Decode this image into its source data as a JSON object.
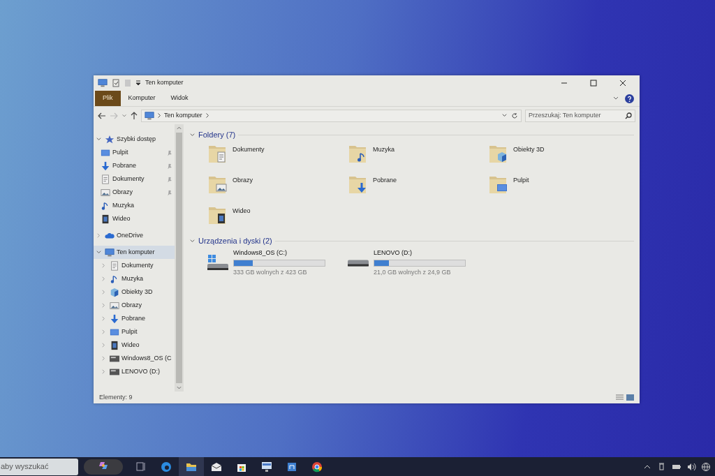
{
  "window": {
    "title": "Ten komputer"
  },
  "ribbon_tabs": [
    {
      "label": "Plik",
      "kind": "file"
    },
    {
      "label": "Komputer",
      "kind": "tab"
    },
    {
      "label": "Widok",
      "kind": "tab"
    }
  ],
  "address": {
    "path": [
      "Ten komputer"
    ]
  },
  "search": {
    "placeholder": "Przeszukaj: Ten komputer"
  },
  "nav": [
    {
      "label": "Szybki dostęp",
      "kind": "star",
      "expanded": true,
      "selected": false,
      "children": [
        {
          "label": "Pulpit",
          "kind": "desktop",
          "pinned": true,
          "selected": false
        },
        {
          "label": "Pobrane",
          "kind": "downloads",
          "pinned": true,
          "selected": false
        },
        {
          "label": "Dokumenty",
          "kind": "documents",
          "pinned": true,
          "selected": false
        },
        {
          "label": "Obrazy",
          "kind": "pictures",
          "pinned": true,
          "selected": false
        },
        {
          "label": "Muzyka",
          "kind": "music",
          "pinned": false,
          "selected": false
        },
        {
          "label": "Wideo",
          "kind": "videos",
          "pinned": false,
          "selected": false
        }
      ]
    },
    {
      "label": "OneDrive",
      "kind": "cloud",
      "expanded": false,
      "selected": false
    },
    {
      "label": "Ten komputer",
      "kind": "computer",
      "expanded": true,
      "selected": true,
      "children": [
        {
          "label": "Dokumenty",
          "kind": "documents",
          "expanded": false,
          "selected": false
        },
        {
          "label": "Muzyka",
          "kind": "music",
          "expanded": false,
          "selected": false
        },
        {
          "label": "Obiekty 3D",
          "kind": "objects3d",
          "expanded": false,
          "selected": false
        },
        {
          "label": "Obrazy",
          "kind": "pictures",
          "expanded": false,
          "selected": false
        },
        {
          "label": "Pobrane",
          "kind": "downloads",
          "expanded": false,
          "selected": false
        },
        {
          "label": "Pulpit",
          "kind": "desktop",
          "expanded": false,
          "selected": false
        },
        {
          "label": "Wideo",
          "kind": "videos",
          "expanded": false,
          "selected": false
        },
        {
          "label": "Windows8_OS (C",
          "kind": "drive",
          "expanded": false,
          "selected": false
        },
        {
          "label": "LENOVO (D:)",
          "kind": "drive",
          "expanded": false,
          "selected": false
        }
      ]
    }
  ],
  "groups": [
    {
      "title": "Foldery (7)",
      "kind": "folders",
      "expanded": true,
      "items": [
        {
          "name": "Dokumenty",
          "kind": "documents"
        },
        {
          "name": "Muzyka",
          "kind": "music"
        },
        {
          "name": "Obiekty 3D",
          "kind": "objects3d"
        },
        {
          "name": "Obrazy",
          "kind": "pictures"
        },
        {
          "name": "Pobrane",
          "kind": "downloads"
        },
        {
          "name": "Pulpit",
          "kind": "desktop"
        },
        {
          "name": "Wideo",
          "kind": "videos"
        }
      ]
    },
    {
      "title": "Urządzenia i dyski (2)",
      "kind": "drives",
      "expanded": true,
      "items": [
        {
          "name": "Windows8_OS (C:)",
          "kind": "windows",
          "level": 0.21,
          "free": "333 GB wolnych z 423 GB"
        },
        {
          "name": "LENOVO (D:)",
          "kind": "plain",
          "level": 0.16,
          "free": "21,0 GB wolnych z 24,9 GB"
        }
      ]
    }
  ],
  "status_bar": {
    "items": "Elementy: 9"
  },
  "taskbar": {
    "search_placeholder": "aby wyszukać",
    "apps": [
      {
        "kind": "copilot",
        "active": false
      },
      {
        "kind": "taskview",
        "active": false
      },
      {
        "kind": "edge",
        "active": false
      },
      {
        "kind": "explorer",
        "active": true
      },
      {
        "kind": "mail",
        "active": false
      },
      {
        "kind": "store",
        "active": false
      },
      {
        "kind": "monitor",
        "active": false
      },
      {
        "kind": "remote",
        "active": false
      },
      {
        "kind": "chrome",
        "active": false
      }
    ]
  }
}
